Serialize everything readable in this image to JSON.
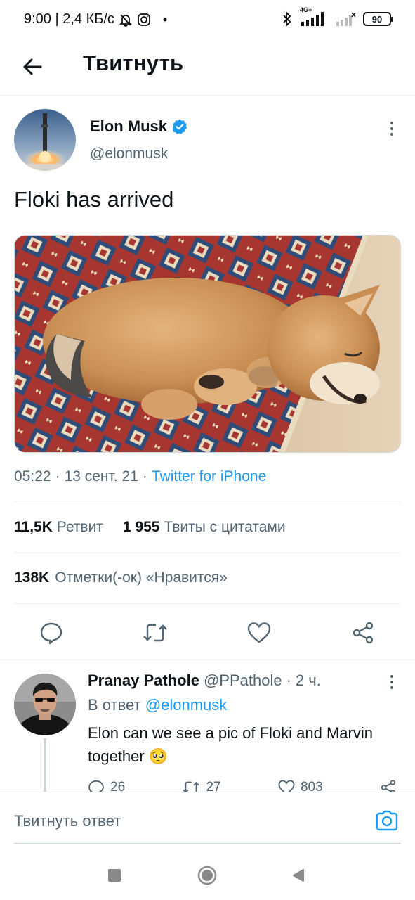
{
  "status_bar": {
    "time_speed": "9:00 | 2,4 КБ/с",
    "battery": "90",
    "network": "4G+",
    "icons": [
      "silent-bell-icon",
      "instagram-icon",
      "dot-icon",
      "bluetooth-icon",
      "signal-icon",
      "signal-weak-icon",
      "battery-icon"
    ]
  },
  "header": {
    "title": "Твитнуть",
    "back_icon": "arrow-left-icon"
  },
  "tweet": {
    "author_name": "Elon Musk",
    "author_handle": "@elonmusk",
    "verified": true,
    "text": "Floki has arrived",
    "time": "05:22",
    "sep1": "·",
    "date": "13 сент. 21",
    "sep2": "·",
    "source": "Twitter for iPhone",
    "retweets_count": "11,5K",
    "retweets_label": "Ретвит",
    "quotes_count": "1 955",
    "quotes_label": "Твиты с цитатами",
    "likes_count": "138K",
    "likes_label": "Отметки(-ок) «Нравится»"
  },
  "reply": {
    "name": "Pranay Pathole",
    "handle": "@PPathole",
    "dot": "·",
    "time": "2 ч.",
    "reply_prefix": "В ответ",
    "reply_mention": "@elonmusk",
    "text": "Elon can we see a pic of Floki and Marvin together 🥺",
    "replies": "26",
    "retweets": "27",
    "likes": "803"
  },
  "composer": {
    "placeholder": "Твитнуть ответ"
  },
  "colors": {
    "accent": "#1d9bf0",
    "text": "#0f1419",
    "muted": "#536471",
    "divider": "#eff3f4"
  }
}
